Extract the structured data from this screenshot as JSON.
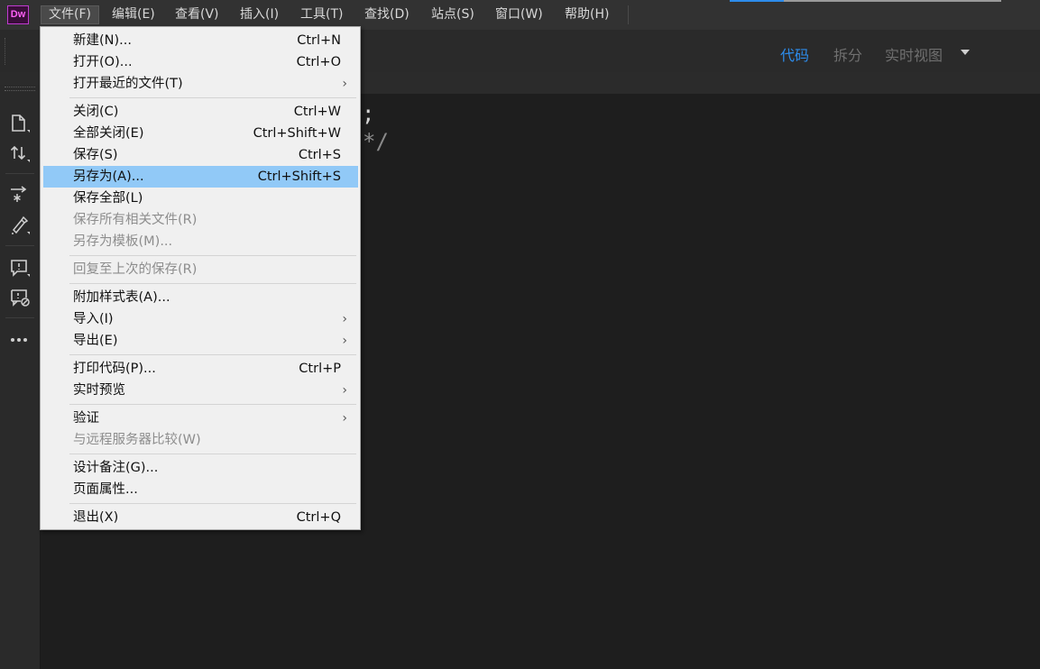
{
  "app": {
    "logo_text": "Dw"
  },
  "menubar": {
    "items": [
      {
        "label": "文件(F)"
      },
      {
        "label": "编辑(E)"
      },
      {
        "label": "查看(V)"
      },
      {
        "label": "插入(I)"
      },
      {
        "label": "工具(T)"
      },
      {
        "label": "查找(D)"
      },
      {
        "label": "站点(S)"
      },
      {
        "label": "窗口(W)"
      },
      {
        "label": "帮助(H)"
      }
    ],
    "active_index": 0
  },
  "view_switcher": {
    "tabs": [
      {
        "label": "代码",
        "active": true
      },
      {
        "label": "拆分",
        "active": false
      },
      {
        "label": "实时视图",
        "active": false
      }
    ],
    "dropdown_icon": "caret-down-icon",
    "accent_color": "#2d8ceb"
  },
  "left_rail": {
    "icons": [
      "file-icon",
      "sort-updown-icon",
      "expand-collapse-icon",
      "snippet-icon",
      "comment-icon",
      "remove-comment-icon",
      "more-icon"
    ]
  },
  "editor": {
    "code_fragment_1": ";",
    "code_fragment_2": "*/"
  },
  "file_menu": {
    "items": [
      {
        "label": "新建(N)...",
        "shortcut": "Ctrl+N"
      },
      {
        "label": "打开(O)...",
        "shortcut": "Ctrl+O"
      },
      {
        "label": "打开最近的文件(T)",
        "submenu": true
      },
      {
        "label": "关闭(C)",
        "shortcut": "Ctrl+W"
      },
      {
        "label": "全部关闭(E)",
        "shortcut": "Ctrl+Shift+W"
      },
      {
        "label": "保存(S)",
        "shortcut": "Ctrl+S"
      },
      {
        "label": "另存为(A)...",
        "shortcut": "Ctrl+Shift+S",
        "highlighted": true
      },
      {
        "label": "保存全部(L)"
      },
      {
        "label": "保存所有相关文件(R)",
        "disabled": true
      },
      {
        "label": "另存为模板(M)...",
        "disabled": true
      },
      {
        "label": "回复至上次的保存(R)",
        "disabled": true
      },
      {
        "label": "附加样式表(A)..."
      },
      {
        "label": "导入(I)",
        "submenu": true
      },
      {
        "label": "导出(E)",
        "submenu": true
      },
      {
        "label": "打印代码(P)...",
        "shortcut": "Ctrl+P"
      },
      {
        "label": "实时预览",
        "submenu": true
      },
      {
        "label": "验证",
        "submenu": true
      },
      {
        "label": "与远程服务器比较(W)",
        "disabled": true
      },
      {
        "label": "设计备注(G)..."
      },
      {
        "label": "页面属性..."
      },
      {
        "label": "退出(X)",
        "shortcut": "Ctrl+Q"
      }
    ],
    "submenu_arrow": "›",
    "highlight_color": "#91c9f7"
  }
}
